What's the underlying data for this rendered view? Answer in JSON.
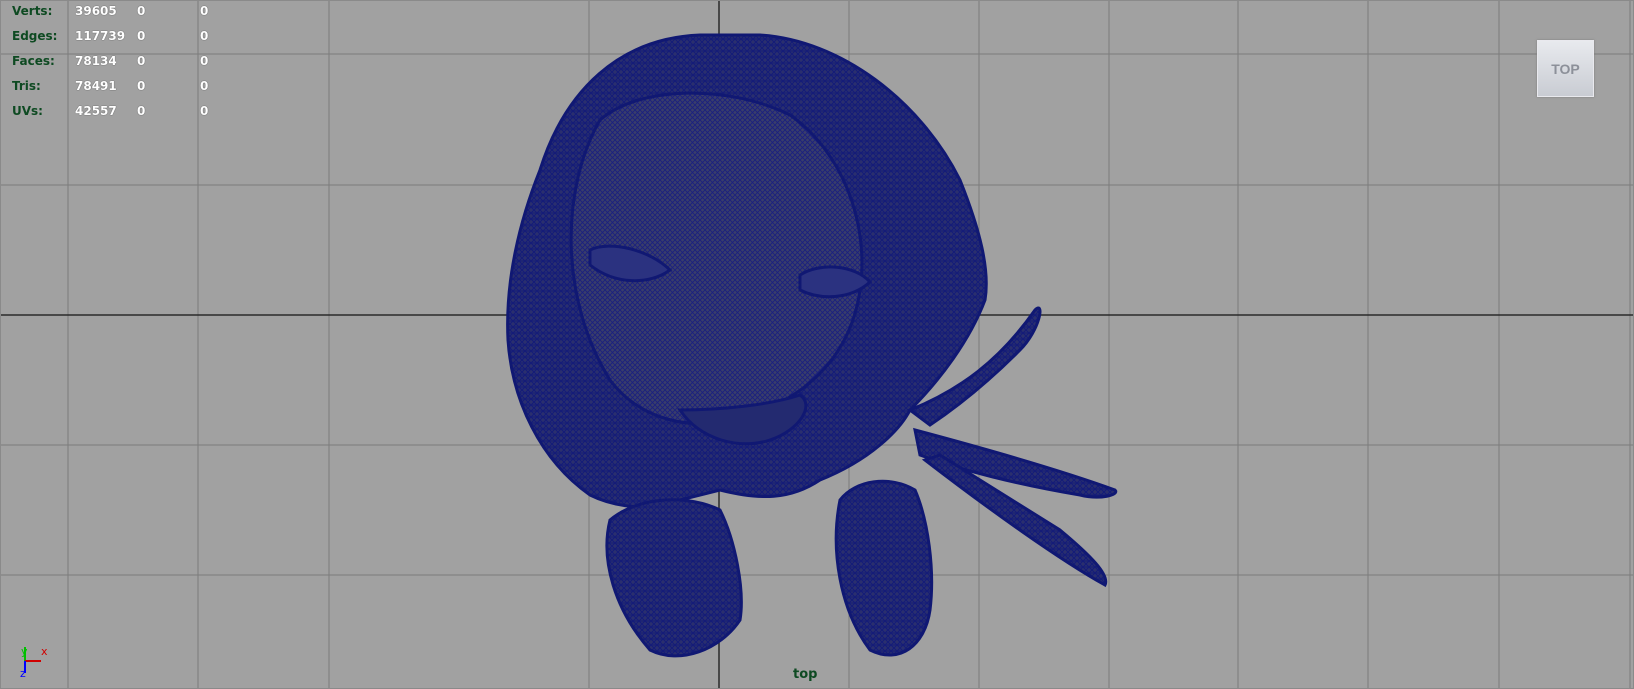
{
  "hud": {
    "rows": [
      {
        "label": "Verts:",
        "v1": "39605",
        "v2": "0",
        "v3": "0"
      },
      {
        "label": "Edges:",
        "v1": "117739",
        "v2": "0",
        "v3": "0"
      },
      {
        "label": "Faces:",
        "v1": "78134",
        "v2": "0",
        "v3": "0"
      },
      {
        "label": "Tris:",
        "v1": "78491",
        "v2": "0",
        "v3": "0"
      },
      {
        "label": "UVs:",
        "v1": "42557",
        "v2": "0",
        "v3": "0"
      }
    ]
  },
  "viewcube": {
    "label": "TOP"
  },
  "camera_label": "top",
  "axis": {
    "y": "y",
    "x": "x",
    "z": "z"
  },
  "colors": {
    "background": "#a1a1a1",
    "grid": "#7c7c7c",
    "axis_line": "#2a2a2a",
    "mesh": "#101873",
    "hud_label": "#0e4a22"
  }
}
